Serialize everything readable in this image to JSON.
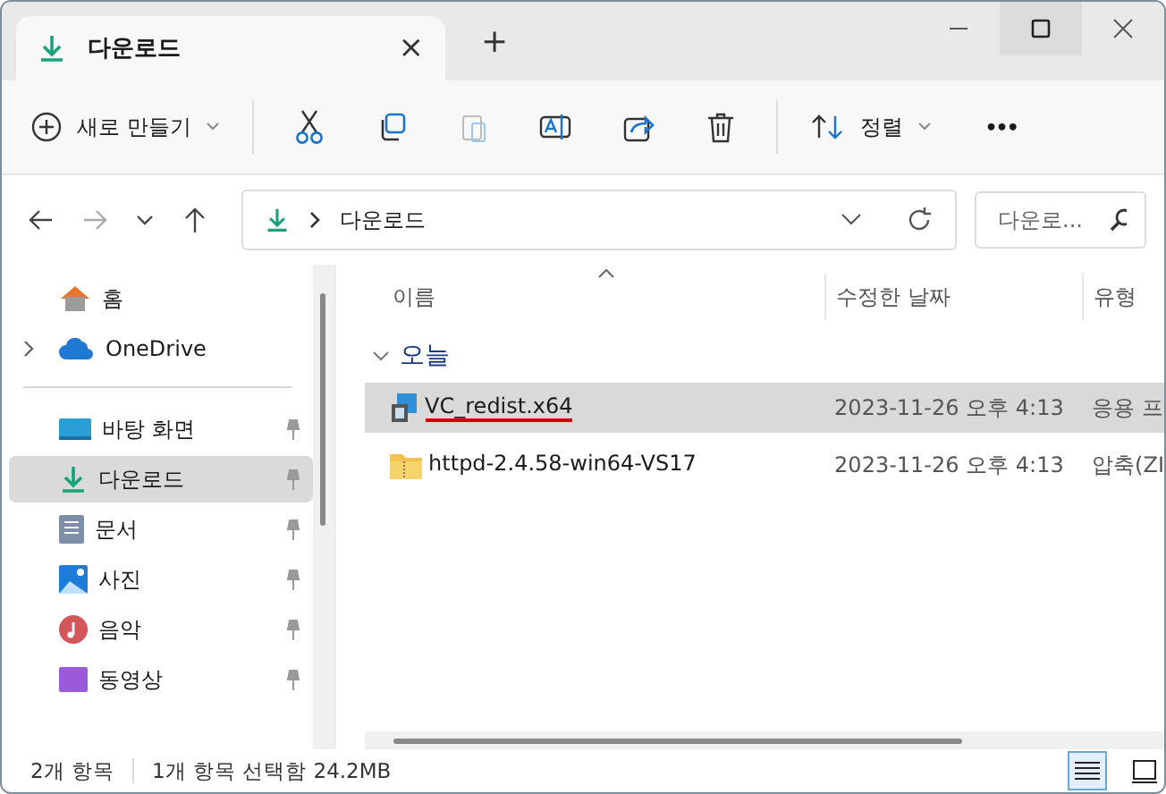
{
  "tab": {
    "title": "다운로드",
    "close": "×",
    "new_tab": "+"
  },
  "toolbar": {
    "new": "새로 만들기",
    "sort": "정렬",
    "more": "•••"
  },
  "address": {
    "path": "다운로드",
    "search_placeholder": "다운로..."
  },
  "sidebar": {
    "groups": [
      [
        {
          "label": "홈",
          "kind": "home",
          "pinned": false,
          "expandable": false,
          "selected": false
        },
        {
          "label": "OneDrive",
          "kind": "cloud",
          "pinned": false,
          "expandable": true,
          "selected": false
        }
      ],
      [
        {
          "label": "바탕 화면",
          "kind": "desktop",
          "pinned": true,
          "expandable": false,
          "selected": false
        },
        {
          "label": "다운로드",
          "kind": "download",
          "pinned": true,
          "expandable": false,
          "selected": true
        },
        {
          "label": "문서",
          "kind": "document",
          "pinned": true,
          "expandable": false,
          "selected": false
        },
        {
          "label": "사진",
          "kind": "picture",
          "pinned": true,
          "expandable": false,
          "selected": false
        },
        {
          "label": "음악",
          "kind": "music",
          "pinned": true,
          "expandable": false,
          "selected": false
        },
        {
          "label": "동영상",
          "kind": "video",
          "pinned": true,
          "expandable": false,
          "selected": false
        }
      ]
    ]
  },
  "table": {
    "columns": [
      "이름",
      "수정한 날짜",
      "유형"
    ],
    "group": "오늘",
    "rows": [
      {
        "name": "VC_redist.x64",
        "date": "2023-11-26 오후 4:13",
        "type": "응용 프",
        "kind": "installer",
        "selected": true,
        "underlined": true
      },
      {
        "name": "httpd-2.4.58-win64-VS17",
        "date": "2023-11-26 오후 4:13",
        "type": "압축(ZI",
        "kind": "zip",
        "selected": false,
        "underlined": false
      }
    ]
  },
  "status_bar": {
    "count": "2개 항목",
    "selection": "1개 항목 선택함 24.2MB",
    "views": [
      {
        "kind": "details",
        "selected": true
      },
      {
        "kind": "tiles",
        "selected": false
      }
    ]
  }
}
